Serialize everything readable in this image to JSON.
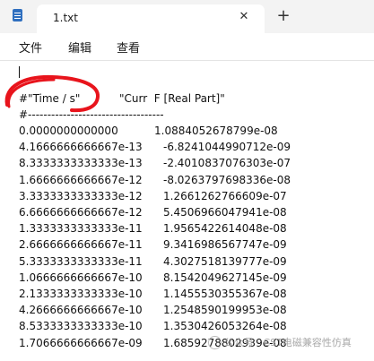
{
  "window": {
    "tab_title": "1.txt",
    "tab_close_glyph": "✕",
    "new_tab_glyph": "+"
  },
  "menu": {
    "items": [
      "文件",
      "编辑",
      "查看"
    ]
  },
  "editor": {
    "blank_line": "|",
    "header_col1": "#\"Time / s\"",
    "header_col2": "\"Curr  F [Real Part]\"",
    "separator": "#-----------------------------------",
    "rows": [
      [
        "0.0000000000000",
        "1.0884052678799e-08"
      ],
      [
        "4.1666666666667e-13",
        "-6.8241044990712e-09"
      ],
      [
        "8.3333333333333e-13",
        "-2.4010837076303e-07"
      ],
      [
        "1.6666666666667e-12",
        "-8.0263797698336e-08"
      ],
      [
        "3.3333333333333e-12",
        "1.2661262766609e-07"
      ],
      [
        "6.6666666666667e-12",
        "5.4506966047941e-08"
      ],
      [
        "1.3333333333333e-11",
        "1.9565422614048e-08"
      ],
      [
        "2.6666666666667e-11",
        "9.3416986567747e-09"
      ],
      [
        "5.3333333333333e-11",
        "4.3027518139777e-09"
      ],
      [
        "1.0666666666667e-10",
        "8.1542049627145e-09"
      ],
      [
        "2.1333333333333e-10",
        "1.1455530355367e-08"
      ],
      [
        "4.2666666666667e-10",
        "1.2548590199953e-08"
      ],
      [
        "8.5333333333333e-10",
        "1.3530426053264e-08"
      ],
      [
        "1.7066666666667e-09",
        "1.6859278802939e-08"
      ]
    ]
  },
  "watermark": {
    "text": "公众号 · CST电磁兼容性仿真"
  },
  "colors": {
    "annotation": "#e8141c",
    "titlebar": "#f3f3f3"
  }
}
